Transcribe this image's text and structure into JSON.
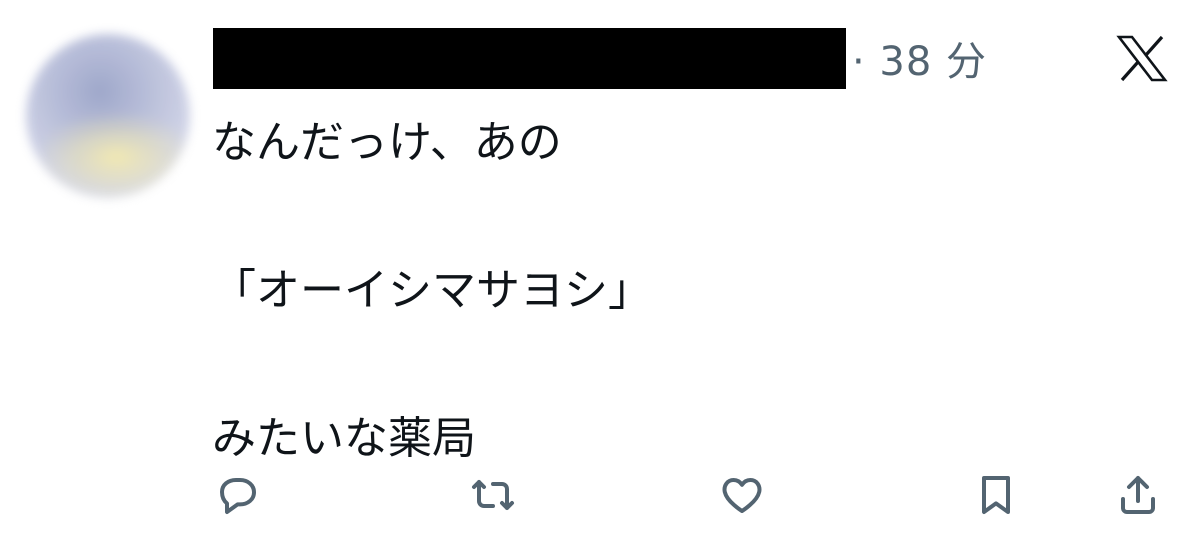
{
  "tweet": {
    "timestamp": "· 38 分",
    "lines": [
      "なんだっけ、あの",
      "",
      "「オーイシマサヨシ」",
      "",
      "みたいな薬局"
    ]
  },
  "icons": {
    "brand": "x-logo-icon",
    "reply": "reply-icon",
    "retweet": "retweet-icon",
    "like": "heart-icon",
    "bookmark": "bookmark-icon",
    "share": "share-icon"
  },
  "colors": {
    "text": "#0f1419",
    "muted": "#536471",
    "redaction": "#000000"
  }
}
